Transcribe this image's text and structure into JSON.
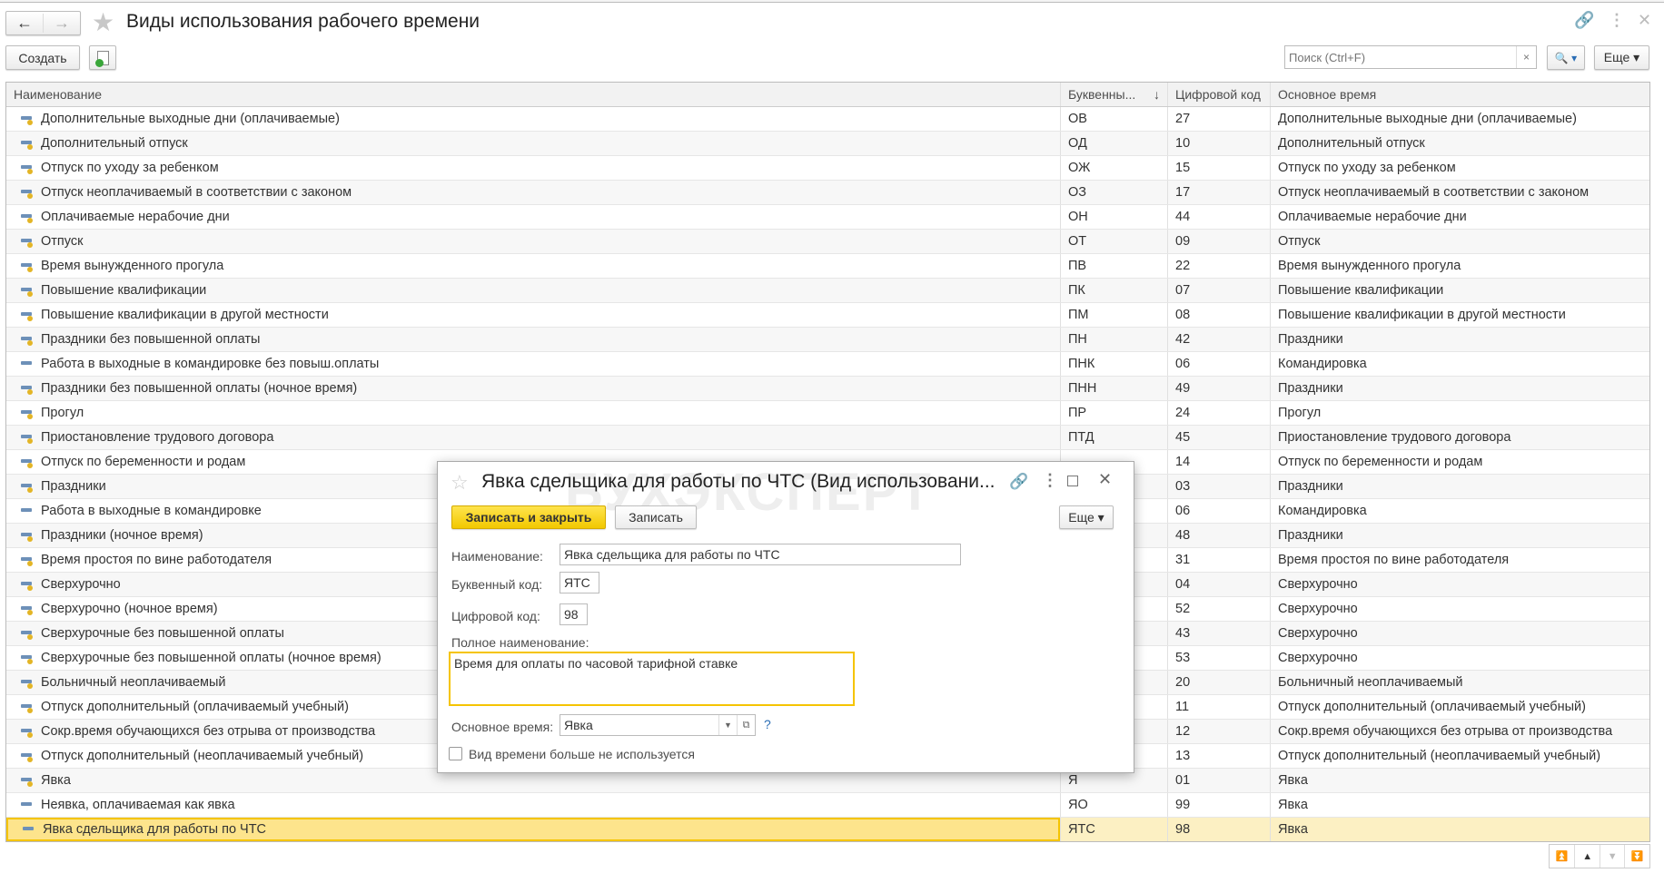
{
  "header": {
    "title": "Виды использования рабочего времени",
    "back": "←",
    "forward": "→"
  },
  "toolbar": {
    "create": "Создать",
    "search_placeholder": "Поиск (Ctrl+F)",
    "search_clear": "×",
    "more": "Еще ▾",
    "search_btn": "🔍 ▾"
  },
  "table": {
    "columns": [
      "Наименование",
      "Буквенны...",
      "Цифровой код",
      "Основное время"
    ],
    "sort_indicator": "↓",
    "rows": [
      {
        "name": "Дополнительные выходные дни (оплачиваемые)",
        "letter": "ОВ",
        "code": "27",
        "main": "Дополнительные выходные дни (оплачиваемые)",
        "icon": "coin"
      },
      {
        "name": "Дополнительный отпуск",
        "letter": "ОД",
        "code": "10",
        "main": "Дополнительный отпуск",
        "icon": "coin"
      },
      {
        "name": "Отпуск по уходу за ребенком",
        "letter": "ОЖ",
        "code": "15",
        "main": "Отпуск по уходу за ребенком",
        "icon": "coin"
      },
      {
        "name": "Отпуск неоплачиваемый в соответствии с законом",
        "letter": "ОЗ",
        "code": "17",
        "main": "Отпуск неоплачиваемый в соответствии с законом",
        "icon": "coin"
      },
      {
        "name": "Оплачиваемые нерабочие дни",
        "letter": "ОН",
        "code": "44",
        "main": "Оплачиваемые нерабочие дни",
        "icon": "coin"
      },
      {
        "name": "Отпуск",
        "letter": "ОТ",
        "code": "09",
        "main": "Отпуск",
        "icon": "coin"
      },
      {
        "name": "Время вынужденного прогула",
        "letter": "ПВ",
        "code": "22",
        "main": "Время вынужденного прогула",
        "icon": "coin"
      },
      {
        "name": "Повышение квалификации",
        "letter": "ПК",
        "code": "07",
        "main": "Повышение квалификации",
        "icon": "coin"
      },
      {
        "name": "Повышение квалификации в другой местности",
        "letter": "ПМ",
        "code": "08",
        "main": "Повышение квалификации в другой местности",
        "icon": "coin"
      },
      {
        "name": "Праздники без повышенной оплаты",
        "letter": "ПН",
        "code": "42",
        "main": "Праздники",
        "icon": "coin"
      },
      {
        "name": "Работа в выходные в командировке без повыш.оплаты",
        "letter": "ПНК",
        "code": "06",
        "main": "Командировка",
        "icon": "plain"
      },
      {
        "name": "Праздники без повышенной оплаты (ночное время)",
        "letter": "ПНН",
        "code": "49",
        "main": "Праздники",
        "icon": "coin"
      },
      {
        "name": "Прогул",
        "letter": "ПР",
        "code": "24",
        "main": "Прогул",
        "icon": "coin"
      },
      {
        "name": "Приостановление трудового договора",
        "letter": "ПТД",
        "code": "45",
        "main": "Приостановление трудового договора",
        "icon": "coin"
      },
      {
        "name": "Отпуск по беременности и родам",
        "letter": "",
        "code": "14",
        "main": "Отпуск по беременности и родам",
        "icon": "coin"
      },
      {
        "name": "Праздники",
        "letter": "",
        "code": "03",
        "main": "Праздники",
        "icon": "coin"
      },
      {
        "name": "Работа в выходные в командировке",
        "letter": "",
        "code": "06",
        "main": "Командировка",
        "icon": "plain"
      },
      {
        "name": "Праздники (ночное время)",
        "letter": "",
        "code": "48",
        "main": "Праздники",
        "icon": "coin"
      },
      {
        "name": "Время простоя по вине работодателя",
        "letter": "",
        "code": "31",
        "main": "Время простоя по вине работодателя",
        "icon": "coin"
      },
      {
        "name": "Сверхурочно",
        "letter": "",
        "code": "04",
        "main": "Сверхурочно",
        "icon": "coin"
      },
      {
        "name": "Сверхурочно (ночное время)",
        "letter": "",
        "code": "52",
        "main": "Сверхурочно",
        "icon": "coin"
      },
      {
        "name": "Сверхурочные без повышенной оплаты",
        "letter": "",
        "code": "43",
        "main": "Сверхурочно",
        "icon": "coin"
      },
      {
        "name": "Сверхурочные без повышенной оплаты (ночное время)",
        "letter": "",
        "code": "53",
        "main": "Сверхурочно",
        "icon": "coin"
      },
      {
        "name": "Больничный неоплачиваемый",
        "letter": "",
        "code": "20",
        "main": "Больничный неоплачиваемый",
        "icon": "coin"
      },
      {
        "name": "Отпуск дополнительный (оплачиваемый учебный)",
        "letter": "",
        "code": "11",
        "main": "Отпуск дополнительный (оплачиваемый учебный)",
        "icon": "coin"
      },
      {
        "name": "Сокр.время обучающихся без отрыва от производства",
        "letter": "",
        "code": "12",
        "main": "Сокр.время обучающихся без отрыва от производства",
        "icon": "coin"
      },
      {
        "name": "Отпуск дополнительный (неоплачиваемый учебный)",
        "letter": "",
        "code": "13",
        "main": "Отпуск дополнительный (неоплачиваемый учебный)",
        "icon": "coin"
      },
      {
        "name": "Явка",
        "letter": "Я",
        "code": "01",
        "main": "Явка",
        "icon": "coin"
      },
      {
        "name": "Неявка, оплачиваемая как явка",
        "letter": "ЯО",
        "code": "99",
        "main": "Явка",
        "icon": "plain"
      },
      {
        "name": "Явка сдельщика для работы по ЧТС",
        "letter": "ЯТС",
        "code": "98",
        "main": "Явка",
        "icon": "plain",
        "selected": true
      }
    ]
  },
  "dialog": {
    "watermark": "БУХЭКСПЕРТ",
    "title": "Явка сдельщика для работы по ЧТС (Вид использовани...",
    "save_close": "Записать и закрыть",
    "save": "Записать",
    "more": "Еще ▾",
    "name_label": "Наименование:",
    "name_value": "Явка сдельщика для работы по ЧТС",
    "letter_label": "Буквенный код:",
    "letter_value": "ЯТС",
    "code_label": "Цифровой код:",
    "code_value": "98",
    "full_label": "Полное наименование:",
    "full_value": "Время для оплаты по часовой тарифной ставке",
    "main_label": "Основное время:",
    "main_value": "Явка",
    "help": "?",
    "unused_label": "Вид времени больше не используется",
    "unused_checked": false
  },
  "colors": {
    "accent": "#f5c400",
    "selected_row": "#fcf0c3",
    "primary_button": "#f2c800"
  }
}
